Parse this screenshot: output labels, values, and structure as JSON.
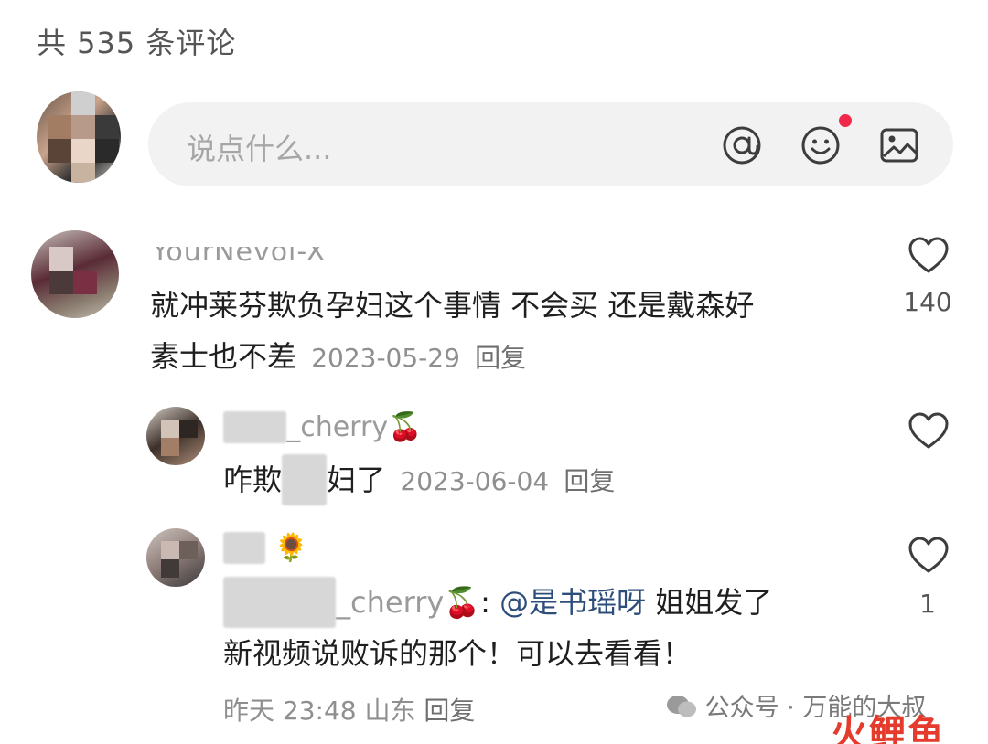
{
  "header": {
    "comment_count": "共 535 条评论"
  },
  "input": {
    "placeholder": "说点什么..."
  },
  "icons": {
    "at": "at-icon",
    "emoji": "emoji-icon",
    "image": "image-icon",
    "like": "heart-icon"
  },
  "colors": {
    "notification_dot": "#f0284a",
    "mention": "#2d4d7a",
    "watermark_logo": "#e53b2c"
  },
  "comments": [
    {
      "user": "YourNevol-X",
      "text_line1": "就冲莱芬欺负孕妇这个事情 不会买 还是戴森好",
      "text_line2": "素士也不差",
      "date": "2023-05-29",
      "reply_label": "回复",
      "likes": "140"
    }
  ],
  "replies": [
    {
      "user_suffix": "_cherry🍒",
      "text_start": "咋欺",
      "text_end": "妇了",
      "date": "2023-06-04",
      "reply_label": "回复"
    },
    {
      "user_suffix": "🌻",
      "reply_target_suffix": "_cherry🍒",
      "colon": ":",
      "mention": "@是书瑶呀",
      "text_line1_tail": "姐姐发了",
      "text_line2": "新视频说败诉的那个！可以去看看！",
      "time": "昨天 23:48",
      "location": "山东",
      "reply_label": "回复",
      "likes": "1"
    }
  ],
  "watermark": {
    "text": "公众号 · 万能的大叔",
    "logo": "火鲤鱼"
  }
}
